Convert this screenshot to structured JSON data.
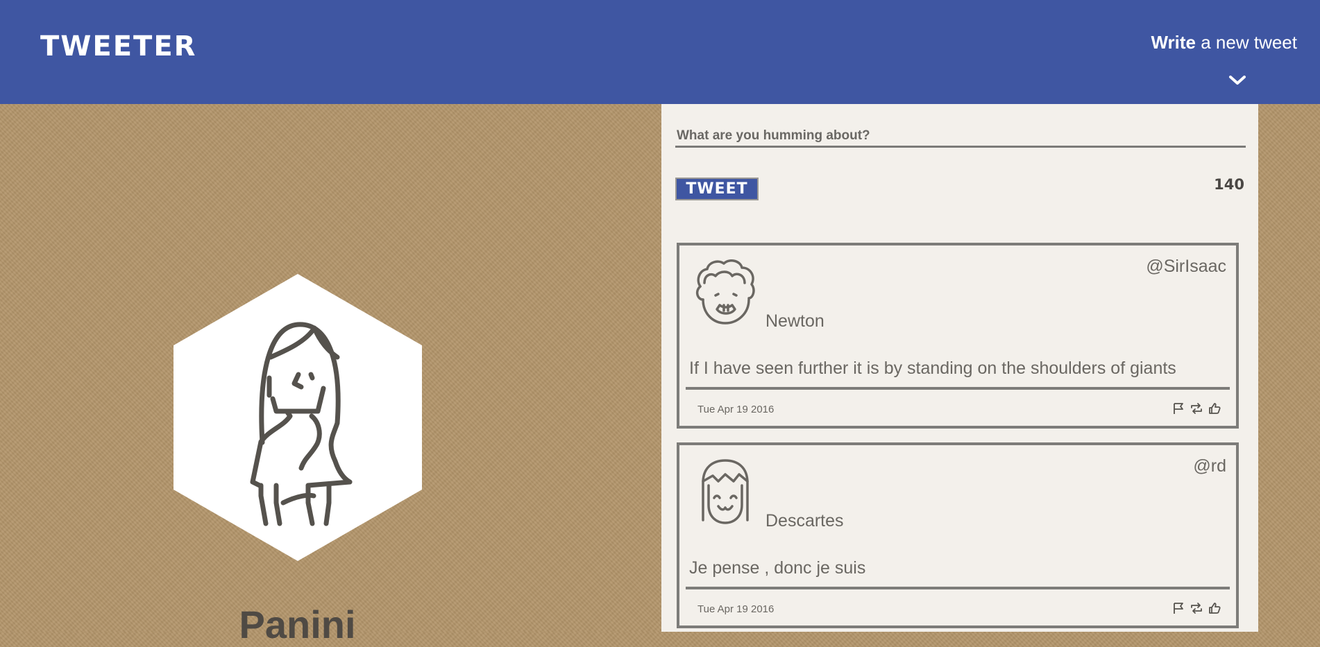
{
  "header": {
    "logo": "TWEETER",
    "compose_bold": "Write",
    "compose_rest": " a new tweet",
    "chevron_icon": "chevron-down-icon"
  },
  "profile": {
    "name": "Panini",
    "avatar_icon": "woman-avatar-icon"
  },
  "compose": {
    "placeholder": "What are you humming about?",
    "value": "",
    "button_label": "TWEET",
    "char_count": "140"
  },
  "tweets": [
    {
      "name": "Newton",
      "handle": "@SirIsaac",
      "text": "If I have seen further it is by standing on the shoulders of giants",
      "date": "Tue Apr 19 2016",
      "avatar_icon": "curly-hair-man-avatar-icon"
    },
    {
      "name": "Descartes",
      "handle": "@rd",
      "text": "Je pense , donc je suis",
      "date": "Tue Apr 19 2016",
      "avatar_icon": "bob-hair-avatar-icon"
    }
  ],
  "colors": {
    "header_bg": "#3f56a2",
    "page_bg": "#b3956a",
    "panel_bg": "#f3f0eb",
    "border": "#7d7c79"
  }
}
